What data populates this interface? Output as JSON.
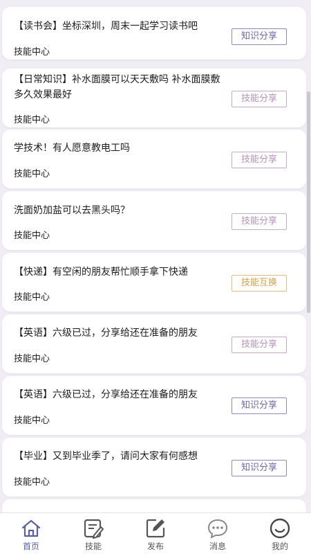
{
  "posts": [
    {
      "title": "【读书会】坐标深圳，周末一起学习读书吧",
      "category": "技能中心",
      "tag": "知识分享"
    },
    {
      "title": "【日常知识】补水面膜可以天天敷吗 补水面膜敷多久效果最好",
      "category": "技能中心",
      "tag": "技能分享"
    },
    {
      "title": "学技术！有人愿意教电工吗",
      "category": "技能中心",
      "tag": "技能分享"
    },
    {
      "title": "洗面奶加盐可以去黑头吗？",
      "category": "技能中心",
      "tag": "技能分享"
    },
    {
      "title": "【快递】有空闲的朋友帮忙顺手拿下快递",
      "category": "技能中心",
      "tag": "技能互换"
    },
    {
      "title": "【英语】六级已过，分享给还在准备的朋友",
      "category": "技能中心",
      "tag": "技能分享"
    },
    {
      "title": "【英语】六级已过，分享给还在准备的朋友",
      "category": "技能中心",
      "tag": "知识分享"
    },
    {
      "title": "【毕业】又到毕业季了，请问大家有何感想",
      "category": "技能中心",
      "tag": "知识分享"
    }
  ],
  "tabbar": {
    "items": [
      {
        "label": "首页",
        "icon": "home-icon",
        "active": true
      },
      {
        "label": "技能",
        "icon": "skills-icon",
        "active": false
      },
      {
        "label": "发布",
        "icon": "publish-icon",
        "active": false
      },
      {
        "label": "消息",
        "icon": "message-icon",
        "active": false
      },
      {
        "label": "我的",
        "icon": "profile-icon",
        "active": false
      }
    ]
  },
  "colors": {
    "accent": "#5a5fa5",
    "tag_knowledge": "#6e67a8",
    "tag_skill": "#b493b8",
    "tag_exchange": "#d2a246",
    "background": "#f0eef4"
  }
}
